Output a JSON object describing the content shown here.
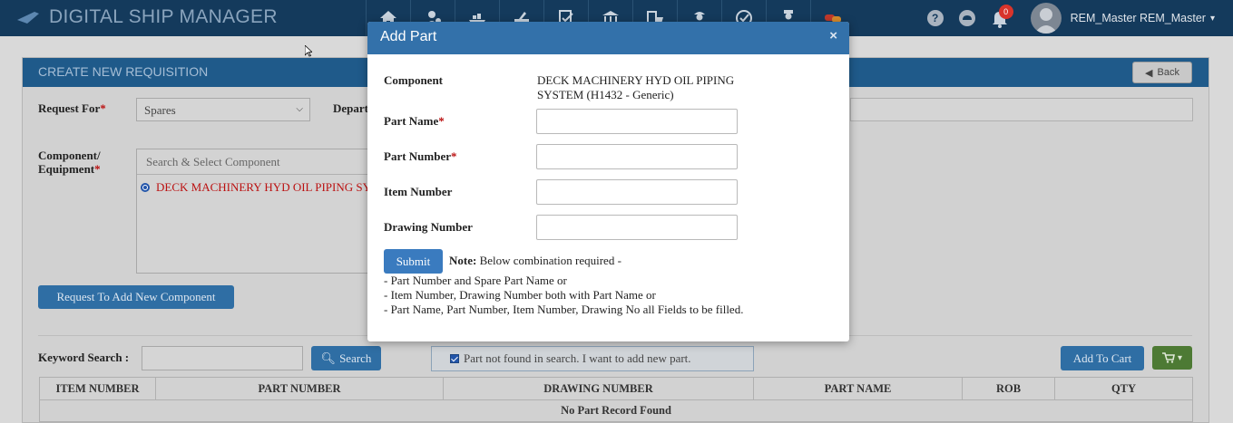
{
  "app": {
    "title": "DIGITAL SHIP MANAGER",
    "user_name": "REM_Master REM_Master",
    "notification_count": "0"
  },
  "nav": {
    "icons": [
      "home-icon",
      "crew-icon",
      "ship-icon",
      "maintenance-icon",
      "checklist-icon",
      "bank-icon",
      "purchase-icon",
      "safety-officer-icon",
      "audit-icon",
      "inspector-icon",
      "chat-icon"
    ]
  },
  "toolbar_right": {
    "help_glyph": "?",
    "caret": "▾"
  },
  "page": {
    "header_title": "CREATE NEW REQUISITION",
    "back_label": "Back",
    "request_for_label": "Request For",
    "request_for_value": "Spares",
    "department_label": "Depart",
    "component_label_line1": "Component/",
    "component_label_line2": "Equipment",
    "component_search_placeholder": "Search & Select Component",
    "component_selected": "DECK MACHINERY HYD OIL PIPING SYS",
    "request_new_component_label": "Request To Add New Component",
    "keyword_label": "Keyword Search :",
    "search_label": "Search",
    "part_not_found_label": "Part not found in search. I want to add new part.",
    "add_to_cart_label": "Add To Cart",
    "required_mark": "*"
  },
  "table": {
    "columns": [
      "ITEM NUMBER",
      "PART NUMBER",
      "DRAWING NUMBER",
      "PART NAME",
      "ROB",
      "QTY"
    ],
    "empty_message": "No Part Record Found"
  },
  "modal": {
    "title": "Add Part",
    "close_glyph": "×",
    "component_label": "Component",
    "component_value": "DECK MACHINERY HYD OIL PIPING SYSTEM (H1432 - Generic)",
    "part_name_label": "Part Name",
    "part_number_label": "Part Number",
    "item_number_label": "Item Number",
    "drawing_number_label": "Drawing Number",
    "submit_label": "Submit",
    "note_prefix": "Note:",
    "note_text": "Below combination required -",
    "rules": [
      "- Part Number and Spare Part Name or",
      "- Item Number, Drawing Number both with Part Name or",
      "- Part Name, Part Number, Item Number, Drawing No all Fields to be filled."
    ]
  },
  "colors": {
    "topbar": "#143a5c",
    "panel_header": "#1f5a8a",
    "modal_header": "#3371aa",
    "primary_button": "#3a7bbf",
    "cart_button": "#4d7a34",
    "required": "#b11111"
  }
}
